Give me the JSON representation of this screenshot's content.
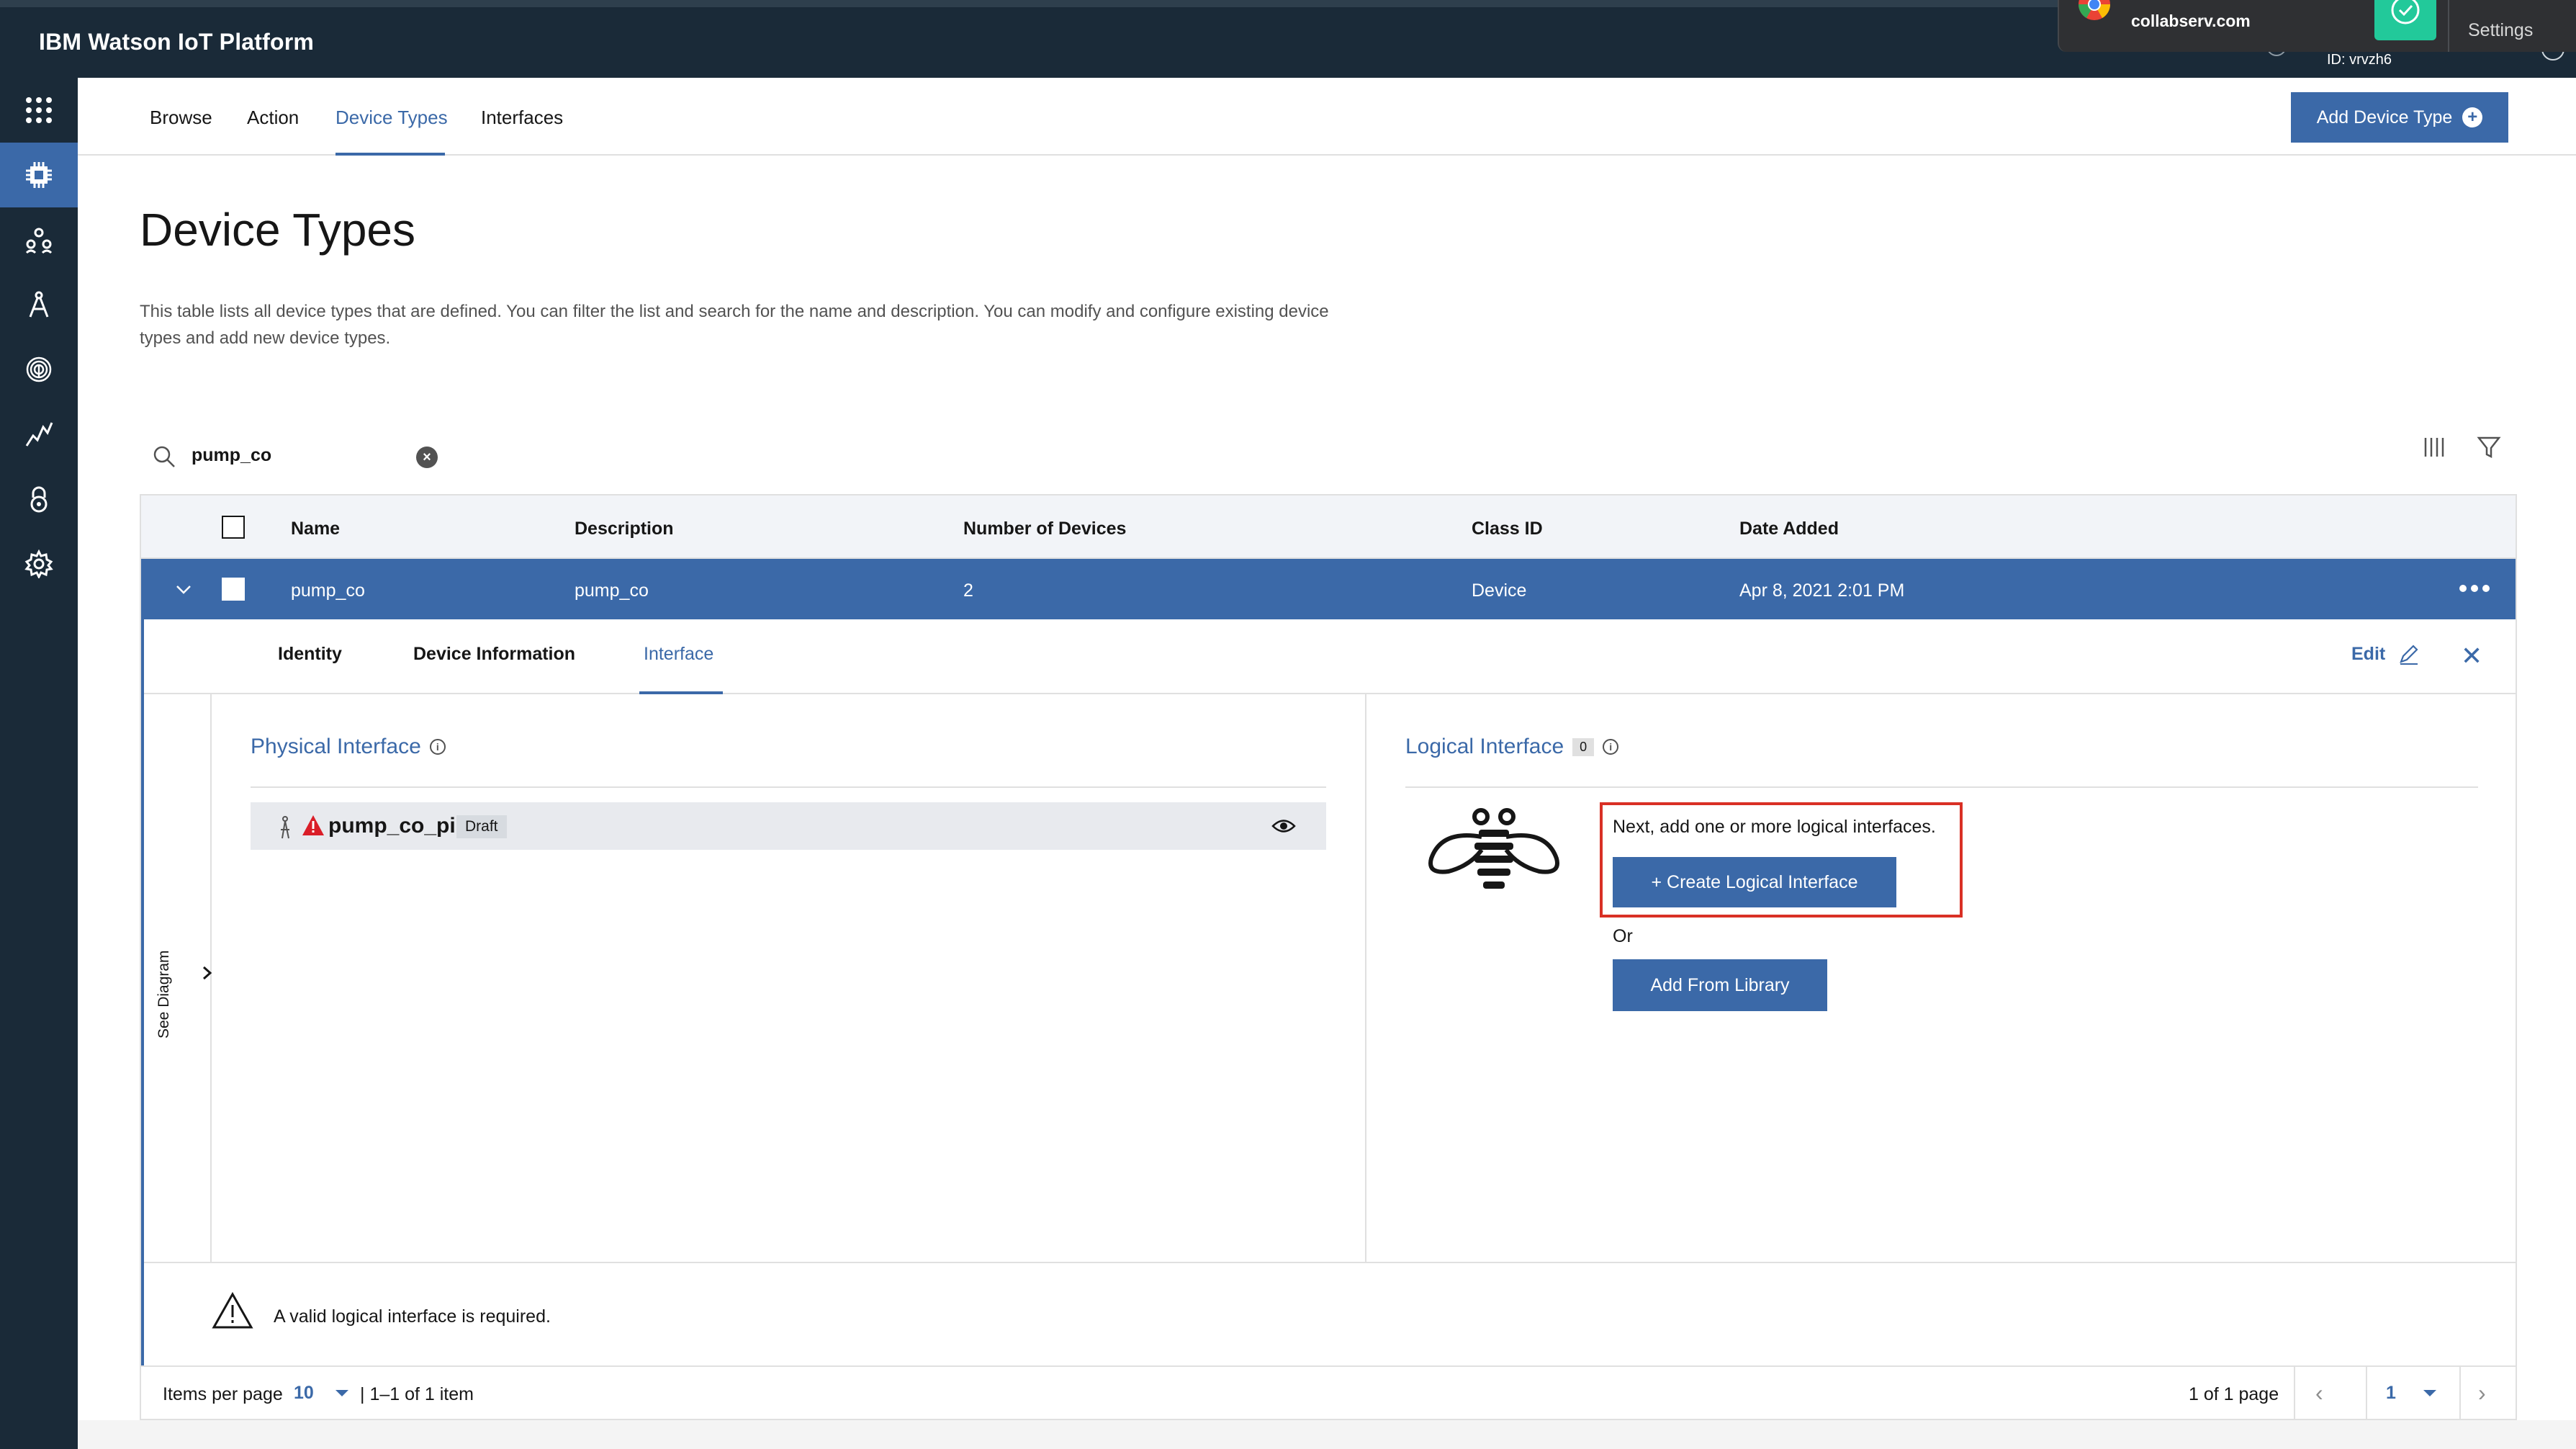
{
  "header": {
    "brand": "IBM Watson IoT Platform",
    "id_text": "ID: vrvzh6"
  },
  "notification": {
    "domain": "collabserv.com",
    "settings_label": "Settings"
  },
  "rail": {
    "items": [
      {
        "icon": "apps-grid-icon"
      },
      {
        "icon": "chip-icon",
        "active": true
      },
      {
        "icon": "members-icon"
      },
      {
        "icon": "apps-compass-icon"
      },
      {
        "icon": "fingerprint-icon"
      },
      {
        "icon": "usage-chart-icon"
      },
      {
        "icon": "security-lock-icon"
      },
      {
        "icon": "settings-gear-icon"
      }
    ]
  },
  "subnav": {
    "tabs": [
      {
        "label": "Browse"
      },
      {
        "label": "Action"
      },
      {
        "label": "Device Types",
        "active": true
      },
      {
        "label": "Interfaces"
      }
    ],
    "add_button": "Add Device Type"
  },
  "page": {
    "title": "Device Types",
    "description": "This table lists all device types that are defined. You can filter the list and search for the name and description. You can modify and configure existing device types and add new device types."
  },
  "search": {
    "value": "pump_co"
  },
  "table": {
    "headers": [
      "Name",
      "Description",
      "Number of Devices",
      "Class ID",
      "Date Added"
    ],
    "row": {
      "name": "pump_co",
      "description": "pump_co",
      "devices": "2",
      "class_id": "Device",
      "date_added": "Apr 8, 2021 2:01 PM"
    }
  },
  "expanded": {
    "tabs": [
      {
        "label": "Identity"
      },
      {
        "label": "Device Information"
      },
      {
        "label": "Interface",
        "active": true
      }
    ],
    "edit_label": "Edit",
    "diagram_label": "See Diagram",
    "physical": {
      "title": "Physical Interface",
      "item_name": "pump_co_pi",
      "item_status": "Draft"
    },
    "logical": {
      "title": "Logical Interface",
      "count": "0",
      "next_text": "Next, add one or more logical interfaces.",
      "create_button": "+ Create Logical Interface",
      "or_text": "Or",
      "library_button": "Add From Library"
    },
    "warning": "A valid logical interface is required."
  },
  "pagination": {
    "items_per_page_label": "Items per page",
    "items_per_page": "10",
    "range": "|  1–1 of 1 item",
    "pages_text": "1 of 1 page",
    "current_page": "1"
  },
  "colors": {
    "accent": "#3b69a8",
    "header_bg": "#1a2a38",
    "highlight_box": "#d93025"
  }
}
